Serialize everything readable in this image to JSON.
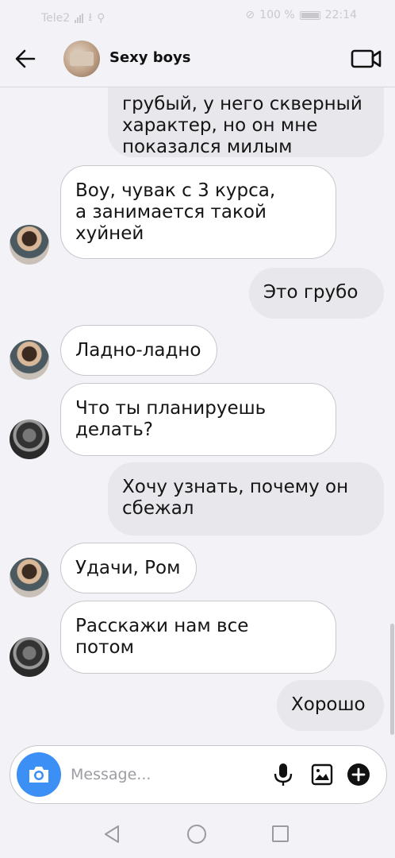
{
  "status_bar": {
    "carrier": "Tele2",
    "battery": "100 %",
    "time": "22:14"
  },
  "header": {
    "title": "Sexy boys",
    "back_icon": "arrow-left-icon",
    "video_icon": "video-camera-icon"
  },
  "messages": [
    {
      "direction": "outgoing",
      "text": "грубый, у него скверный\nхарактер, но он мне\nпоказался милым"
    },
    {
      "direction": "incoming",
      "sender_avatar": "avatar-a",
      "text": "Воу, чувак с 3 курса,\nа занимается такой\nхуйней"
    },
    {
      "direction": "outgoing",
      "text": "Это грубо"
    },
    {
      "direction": "incoming",
      "sender_avatar": "avatar-a",
      "text": "Ладно-ладно"
    },
    {
      "direction": "incoming",
      "sender_avatar": "avatar-b",
      "text": "Что ты планируешь\nделать?"
    },
    {
      "direction": "outgoing",
      "text": "Хочу узнать, почему он\nсбежал"
    },
    {
      "direction": "incoming",
      "sender_avatar": "avatar-a",
      "text": "Удачи, Ром"
    },
    {
      "direction": "incoming",
      "sender_avatar": "avatar-b",
      "text": "Расскажи нам все\nпотом"
    },
    {
      "direction": "outgoing",
      "text": "Хорошо"
    }
  ],
  "composer": {
    "placeholder": "Message...",
    "camera_icon": "camera-icon",
    "mic_icon": "microphone-icon",
    "gallery_icon": "image-gallery-icon",
    "plus_icon": "plus-circle-icon"
  },
  "colors": {
    "accent": "#3b8ff5",
    "background": "#f3f2f6",
    "outgoing_bubble": "#e8e7eb",
    "incoming_bubble": "#ffffff"
  }
}
